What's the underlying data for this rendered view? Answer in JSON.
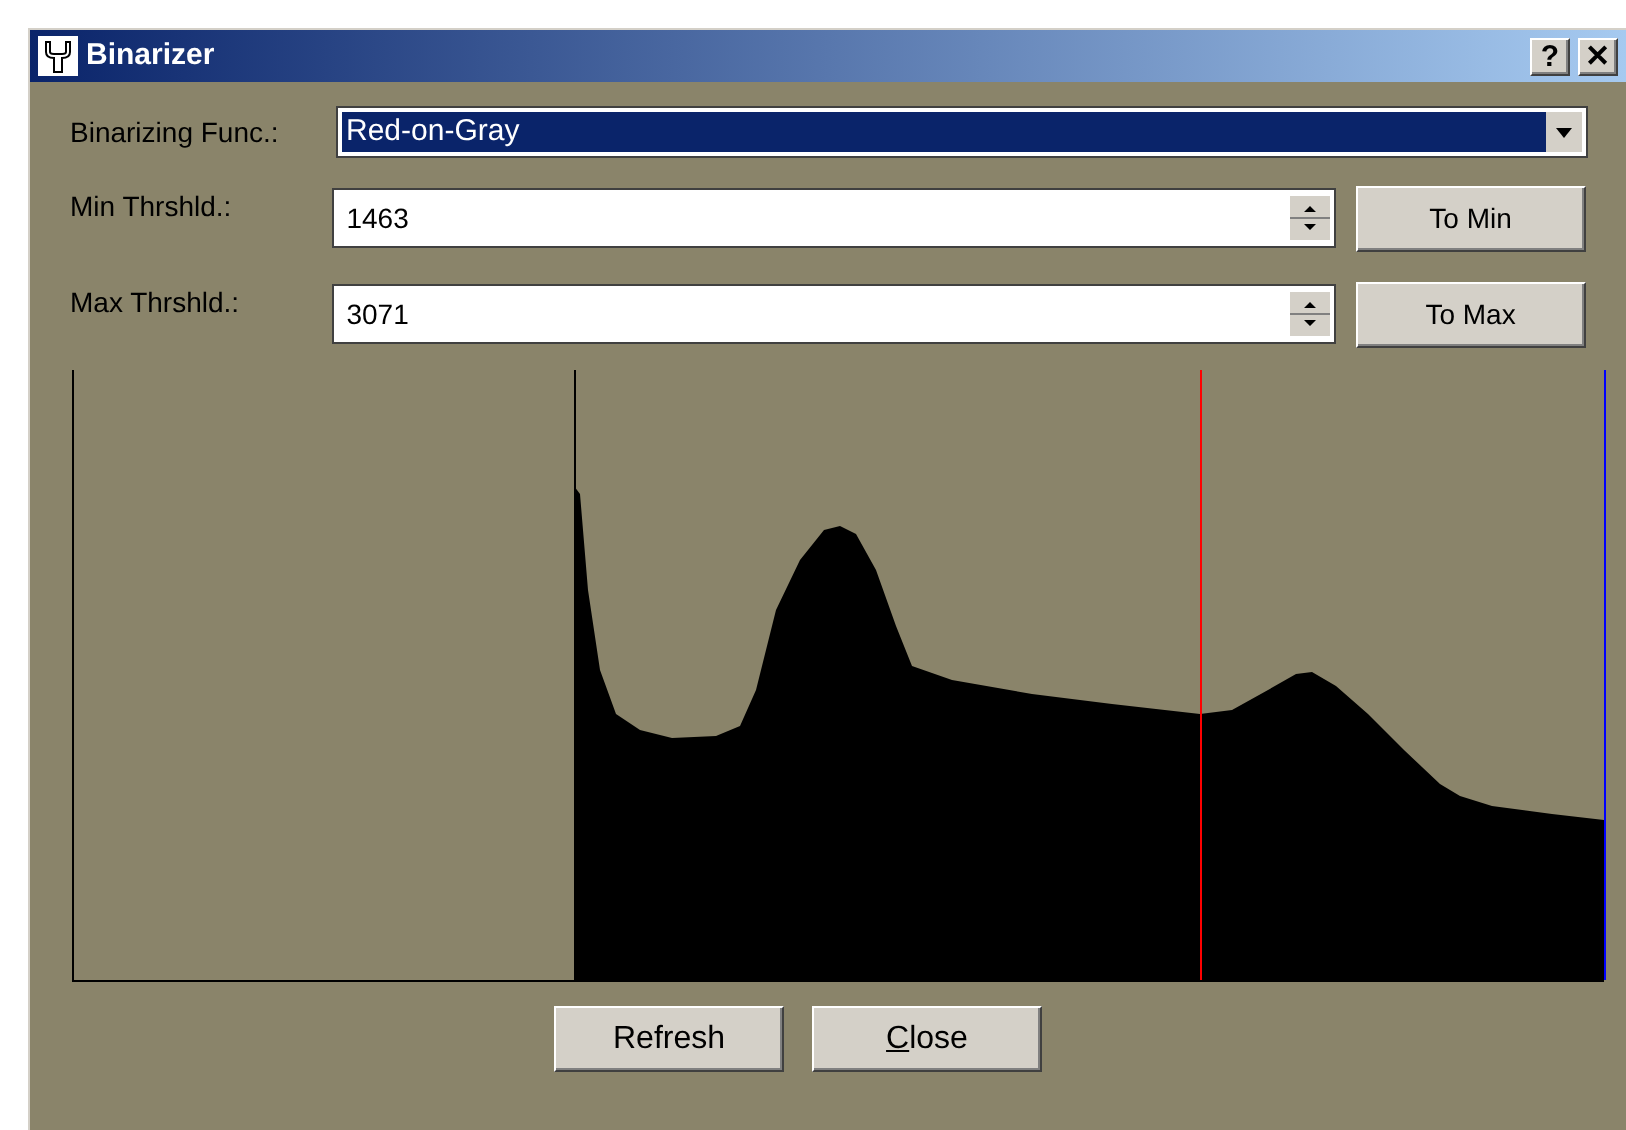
{
  "window": {
    "title": "Binarizer",
    "buttons": [
      "?",
      "✕"
    ]
  },
  "function": {
    "label": "Binarizing Func.:",
    "value": "Red-on-Gray"
  },
  "thresholds": [
    {
      "label": "Min Thrshld.:",
      "value": "1463",
      "button": "To Min"
    },
    {
      "label": "Max Thrshld.:",
      "value": "3071",
      "button": "To Max"
    }
  ],
  "buttons": [
    {
      "label": "Refresh",
      "accelerator": false
    },
    {
      "label": "Close",
      "accelerator": true
    }
  ]
}
